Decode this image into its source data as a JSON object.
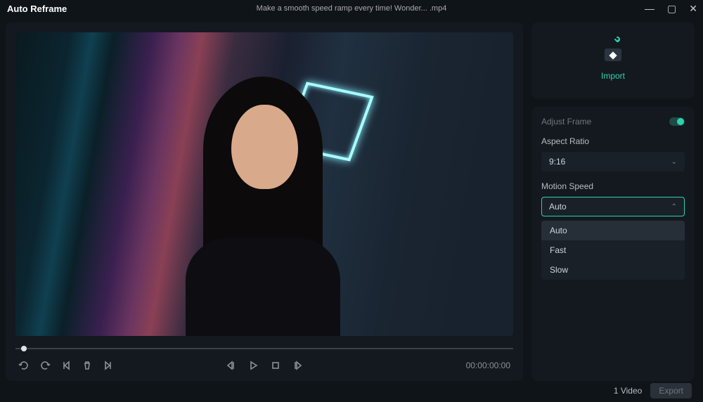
{
  "titlebar": {
    "app_title": "Auto Reframe",
    "file_title": "Make a smooth speed ramp every time!  Wonder... .mp4"
  },
  "preview": {
    "timecode": "00:00:00:00"
  },
  "sidebar": {
    "import_label": "Import",
    "adjust_frame_label": "Adjust Frame",
    "aspect_ratio_label": "Aspect Ratio",
    "aspect_ratio_value": "9:16",
    "motion_speed_label": "Motion Speed",
    "motion_speed_value": "Auto",
    "motion_speed_options": [
      "Auto",
      "Fast",
      "Slow"
    ]
  },
  "footer": {
    "video_count": "1 Video",
    "export_label": "Export"
  }
}
